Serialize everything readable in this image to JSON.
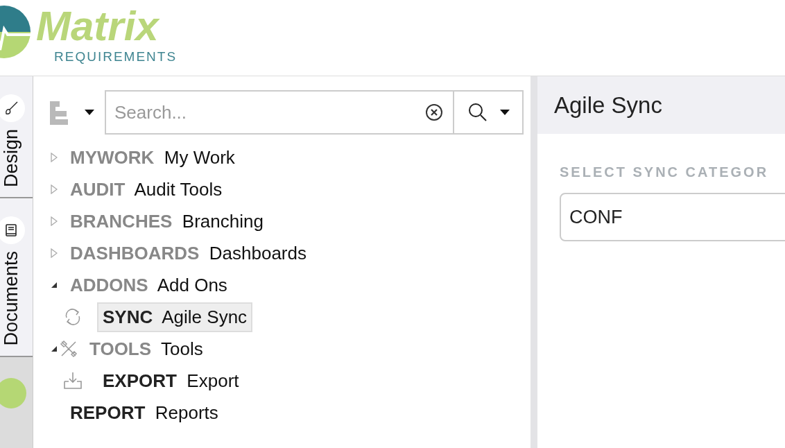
{
  "logo": {
    "name": "Matrix",
    "tagline": "REQUIREMENTS"
  },
  "rail": {
    "tabs": [
      {
        "label": "Design",
        "kind": "brush"
      },
      {
        "label": "Documents",
        "kind": "book"
      }
    ]
  },
  "search": {
    "placeholder": "Search..."
  },
  "tree": [
    {
      "code": "MYWORK",
      "label": "My Work",
      "expanded": false,
      "selected": false
    },
    {
      "code": "AUDIT",
      "label": "Audit Tools",
      "expanded": false,
      "selected": false
    },
    {
      "code": "BRANCHES",
      "label": "Branching",
      "expanded": false,
      "selected": false
    },
    {
      "code": "DASHBOARDS",
      "label": "Dashboards",
      "expanded": false,
      "selected": false
    },
    {
      "code": "ADDONS",
      "label": "Add Ons",
      "expanded": true,
      "selected": false,
      "children": [
        {
          "code": "SYNC",
          "label": "Agile Sync",
          "kind": "sync",
          "selected": true
        }
      ]
    },
    {
      "code": "TOOLS",
      "label": "Tools",
      "expanded": true,
      "kind": "tools",
      "selected": false,
      "children": [
        {
          "code": "EXPORT",
          "label": "Export",
          "kind": "download",
          "selected": false
        }
      ]
    },
    {
      "code": "REPORT",
      "label": "Reports",
      "selected": false
    }
  ],
  "panel": {
    "title": "Agile Sync",
    "field_label": "SELECT SYNC CATEGOR",
    "field_value": "CONF"
  }
}
